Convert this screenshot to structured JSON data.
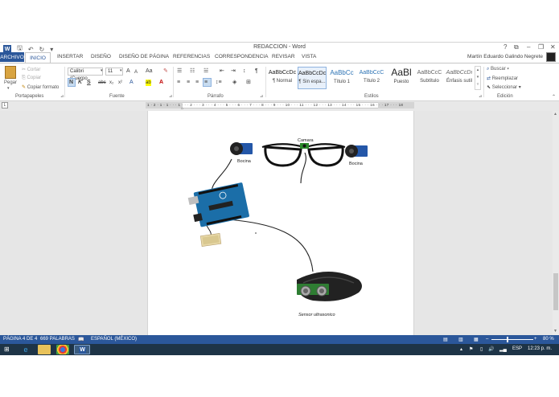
{
  "window": {
    "title": "REDACCION - Word",
    "app_icon": "W"
  },
  "title_controls": {
    "help": "?",
    "ribbon_options": "⧉",
    "minimize": "–",
    "restore": "❐",
    "close": "✕"
  },
  "tabs": [
    {
      "label": "ARCHIVO"
    },
    {
      "label": "INICIO"
    },
    {
      "label": "INSERTAR"
    },
    {
      "label": "DISEÑO"
    },
    {
      "label": "DISEÑO DE PÁGINA"
    },
    {
      "label": "REFERENCIAS"
    },
    {
      "label": "CORRESPONDENCIA"
    },
    {
      "label": "REVISAR"
    },
    {
      "label": "VISTA"
    }
  ],
  "user": {
    "name": "Martín Eduardo Galindo Negrete"
  },
  "clipboard": {
    "paste": "Pegar",
    "cut": "Cortar",
    "copy": "Copiar",
    "format_painter": "Copiar formato",
    "group": "Portapapeles"
  },
  "font": {
    "name": "Calibri (Cuerpo",
    "size": "11",
    "group": "Fuente",
    "bold": "N",
    "italic": "K",
    "underline": "S",
    "strike": "abc",
    "sub": "x₂",
    "sup": "x²",
    "case": "Aa",
    "grow": "A",
    "shrink": "A"
  },
  "paragraph": {
    "group": "Párrafo",
    "pilcrow": "¶"
  },
  "styles": {
    "group": "Estilos",
    "items": [
      {
        "sample": "AaBbCcDc",
        "name": "¶ Normal"
      },
      {
        "sample": "AaBbCcDc",
        "name": "¶ Sin espa..."
      },
      {
        "sample": "AaBbCc",
        "name": "Título 1"
      },
      {
        "sample": "AaBbCcC",
        "name": "Título 2"
      },
      {
        "sample": "AaBl",
        "name": "Puesto"
      },
      {
        "sample": "AaBbCcC",
        "name": "Subtítulo"
      },
      {
        "sample": "AaBbCcDı",
        "name": "Énfasis sutil"
      }
    ]
  },
  "editing": {
    "group": "Edición",
    "find": "Buscar",
    "replace": "Reemplazar",
    "select": "Seleccionar"
  },
  "ruler": {
    "marks": "1 · 2 · 1 · 1 · · · 1 · · · 2 · · · 3 · · · 4 · · · 5 · · · 6 · · · 7 · · · 8 · · · 9 · · · 10 · · · 11 · · · 12 · · · 13 · · · 14 · · · 15 · · · 16 · · · 17 · · · 18"
  },
  "diagram": {
    "camera": "Camara",
    "speaker_left": "Bocina",
    "speaker_right": "Bocina",
    "ultrasonic": "Sensor ultrasonico"
  },
  "status": {
    "page": "PÁGINA 4 DE 4",
    "words": "669 PALABRAS",
    "language": "ESPAÑOL (MÉXICO)",
    "zoom": "80 %",
    "zoom_level": 0.8
  },
  "taskbar": {
    "language": "ESP",
    "time": "12:23 p. m."
  },
  "colors": {
    "accent": "#2b579a",
    "taskbar": "#1e3447"
  }
}
